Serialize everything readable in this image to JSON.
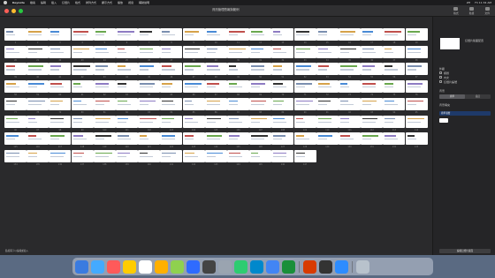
{
  "menubar": {
    "app": "Keynote",
    "items": [
      "檔案",
      "編輯",
      "插入",
      "幻燈片",
      "格式",
      "排列方式",
      "顯示方式",
      "播放",
      "視窗",
      "輔助說明"
    ],
    "right": [
      "ZH",
      "Fri 11:34 AM"
    ]
  },
  "window": {
    "title": "資訊管理簡報與範例"
  },
  "toolbar": {
    "right": [
      "格式",
      "動畫",
      "文件"
    ]
  },
  "slides": {
    "count": 147,
    "columns": 19
  },
  "sidebar": {
    "slide_title": "幻燈片版面配置",
    "labels": [
      "外觀",
      "標題",
      "內文",
      "幻燈片編號",
      "背景",
      "背景填充",
      "背景顏色"
    ],
    "checks": [
      "標題",
      "內文",
      "幻燈片編號"
    ],
    "segment": [
      "標準",
      "自訂"
    ],
    "select_value": "標準漸層",
    "button": "編輯幻燈片版面"
  },
  "statusbar": {
    "text": "點按兩下以編輯或插入"
  },
  "dock": {
    "colors": [
      "#3a7be0",
      "#44aaff",
      "#ff5a5a",
      "#ffcc00",
      "#ffffff",
      "#ffb000",
      "#8fd14f",
      "#2f6bff",
      "#444444",
      "#9aa4b0",
      "#2ecc71",
      "#0088cc",
      "#4285f4",
      "#1a8f3a",
      "#d83b01",
      "#333333",
      "#2d8cff"
    ]
  }
}
